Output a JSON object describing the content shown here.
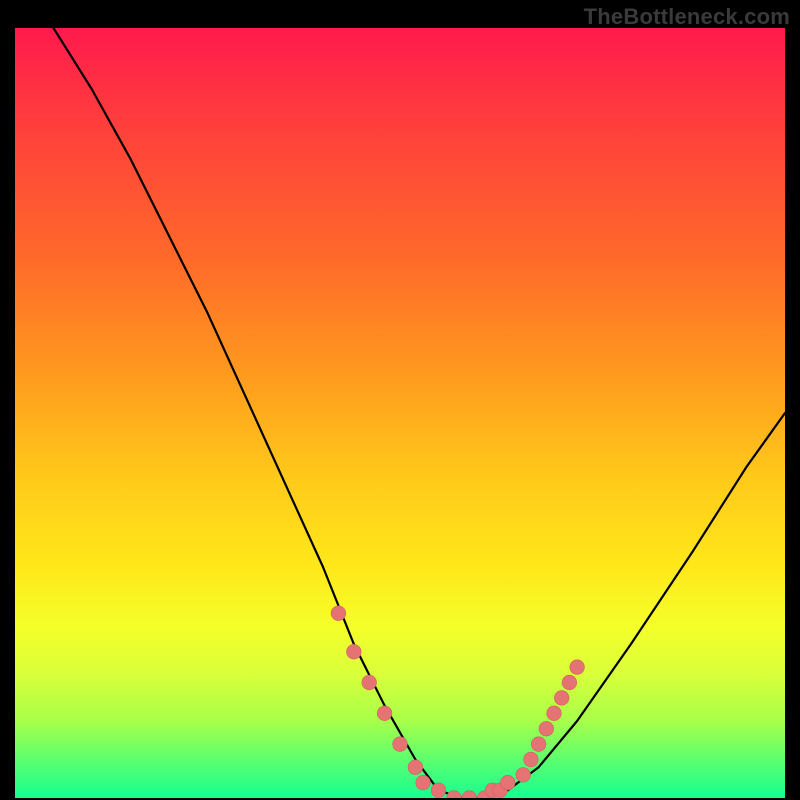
{
  "watermark": "TheBottleneck.com",
  "chart_data": {
    "type": "line",
    "title": "",
    "xlabel": "",
    "ylabel": "",
    "xlim": [
      0,
      100
    ],
    "ylim": [
      0,
      100
    ],
    "grid": false,
    "legend": false,
    "background": "red-to-green vertical heat gradient",
    "series": [
      {
        "name": "curve",
        "x": [
          5,
          10,
          15,
          20,
          25,
          30,
          35,
          40,
          44,
          48,
          52,
          55,
          58,
          61,
          64,
          68,
          73,
          80,
          88,
          95,
          100
        ],
        "y": [
          100,
          92,
          83,
          73,
          63,
          52,
          41,
          30,
          20,
          12,
          5,
          1,
          0,
          0,
          1,
          4,
          10,
          20,
          32,
          43,
          50
        ]
      }
    ],
    "markers": [
      {
        "x": 42,
        "y": 24
      },
      {
        "x": 44,
        "y": 19
      },
      {
        "x": 46,
        "y": 15
      },
      {
        "x": 48,
        "y": 11
      },
      {
        "x": 50,
        "y": 7
      },
      {
        "x": 52,
        "y": 4
      },
      {
        "x": 53,
        "y": 2
      },
      {
        "x": 55,
        "y": 1
      },
      {
        "x": 57,
        "y": 0
      },
      {
        "x": 59,
        "y": 0
      },
      {
        "x": 61,
        "y": 0
      },
      {
        "x": 62,
        "y": 1
      },
      {
        "x": 63,
        "y": 1
      },
      {
        "x": 64,
        "y": 2
      },
      {
        "x": 66,
        "y": 3
      },
      {
        "x": 67,
        "y": 5
      },
      {
        "x": 68,
        "y": 7
      },
      {
        "x": 69,
        "y": 9
      },
      {
        "x": 70,
        "y": 11
      },
      {
        "x": 71,
        "y": 13
      },
      {
        "x": 72,
        "y": 15
      },
      {
        "x": 73,
        "y": 17
      }
    ]
  },
  "colors": {
    "frame": "#000000",
    "curve": "#000000",
    "marker": "#e57373",
    "watermark": "#3a3a3a"
  }
}
